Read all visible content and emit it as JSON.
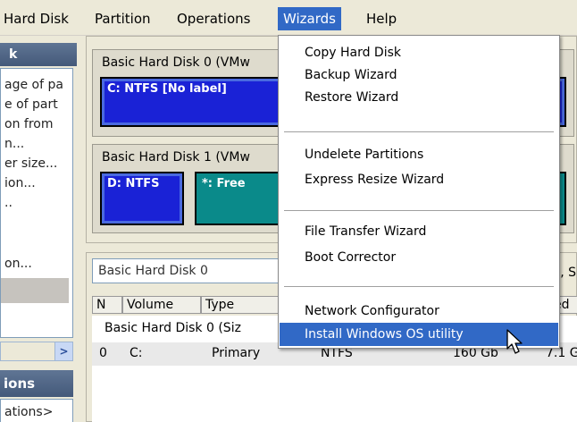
{
  "menubar": {
    "items": [
      "Hard Disk",
      "Partition",
      "Operations",
      "Wizards",
      "Help"
    ]
  },
  "sidebar": {
    "header": "k",
    "items": [
      "age of pa",
      "e of part",
      "on from",
      "n...",
      "er size...",
      "ion...",
      "..",
      "on..."
    ],
    "ops_header": "ions",
    "ops_item": "ations>"
  },
  "diskmap": {
    "disk0": {
      "title": "Basic Hard Disk 0 (VMw",
      "partition_c": "C: NTFS [No label]"
    },
    "disk1": {
      "title": "Basic Hard Disk 1 (VMw",
      "partition_d": "D: NTFS",
      "partition_free": "*: Free"
    }
  },
  "plist": {
    "search_value": "Basic Hard Disk 0",
    "right_label": "l, S",
    "columns": [
      "N",
      "Volume",
      "Type",
      "ed"
    ],
    "group_label": "Basic Hard Disk 0 (Siz",
    "row": {
      "n": "0",
      "volume": "C:",
      "type": "Primary",
      "fs": "NTFS",
      "size": "160 Gb",
      "used": "7.1 G"
    }
  },
  "wizards_menu": {
    "items": [
      "Copy Hard Disk",
      "Backup Wizard",
      "Restore Wizard",
      "Undelete Partitions",
      "Express Resize Wizard",
      "File Transfer Wizard",
      "Boot Corrector",
      "Network Configurator",
      "Install Windows OS utility"
    ],
    "highlighted": "Install Windows OS utility"
  },
  "colors": {
    "highlight": "#3169c6",
    "ntfs_partition": "#1a22d6",
    "free_partition": "#0a8a8a"
  }
}
